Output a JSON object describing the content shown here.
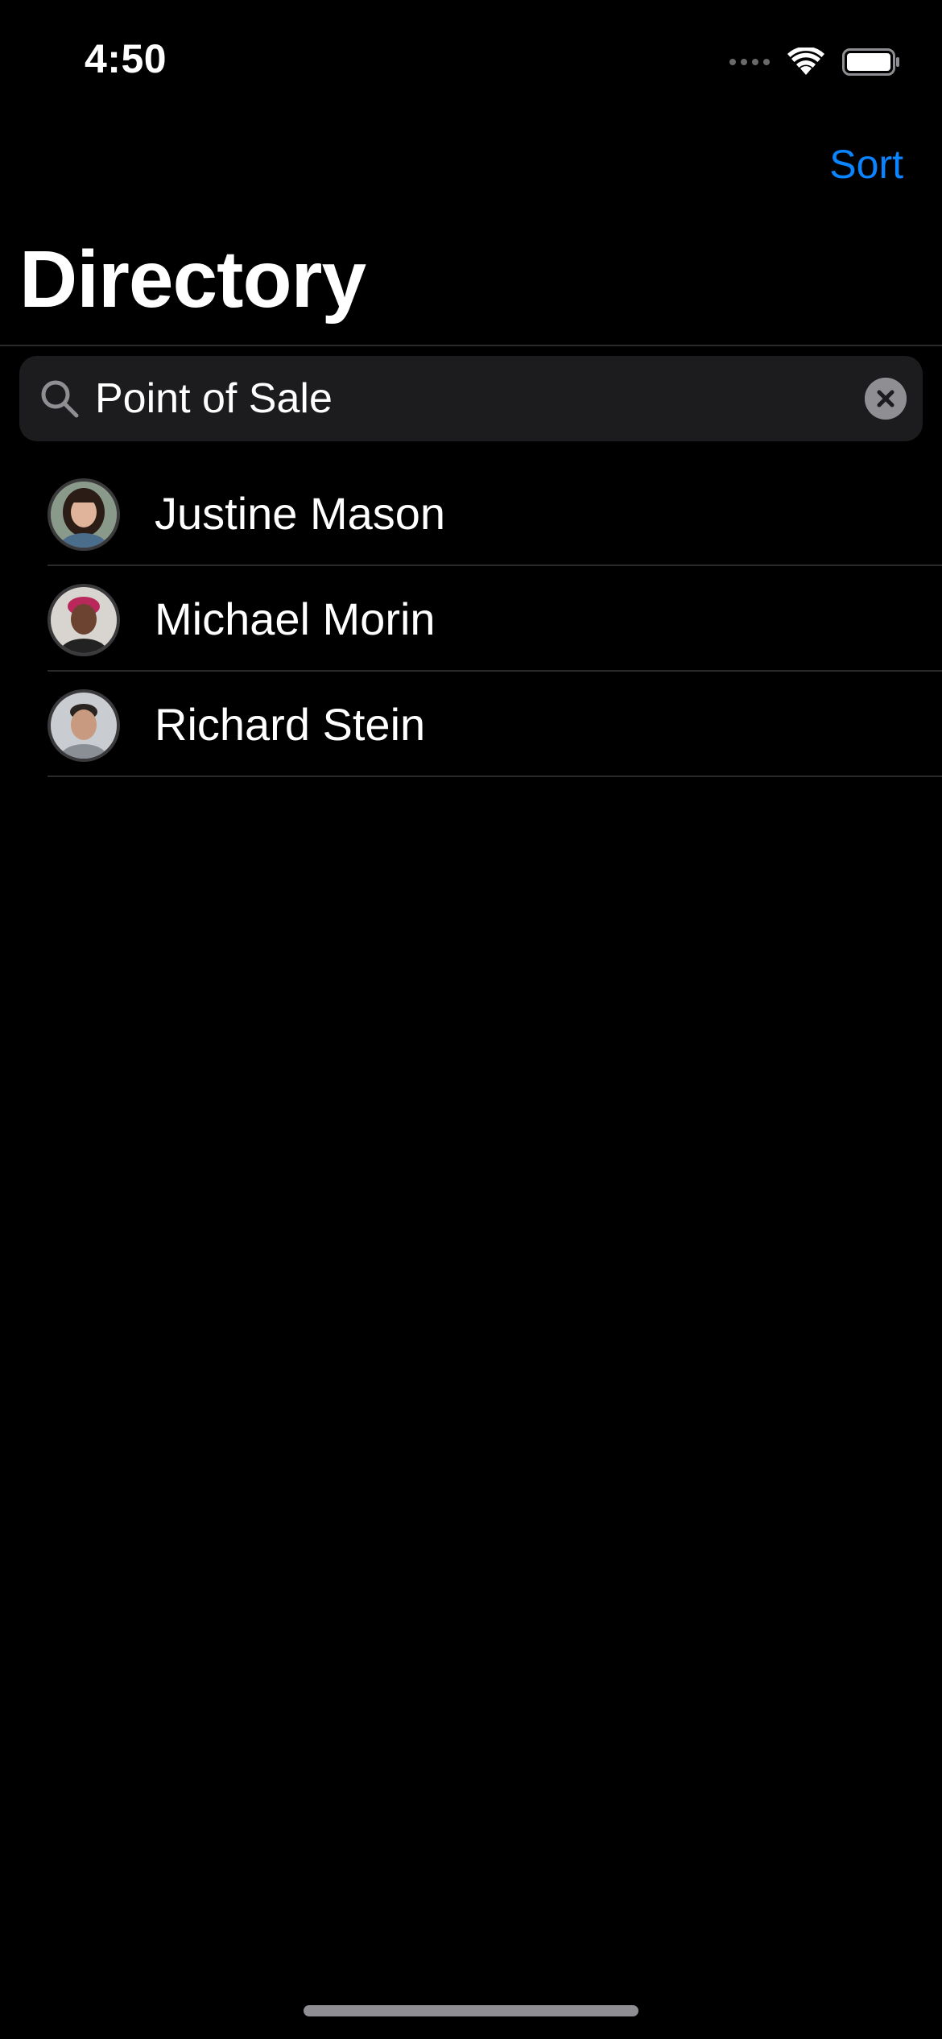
{
  "status_bar": {
    "time": "4:50"
  },
  "nav": {
    "sort_label": "Sort",
    "title": "Directory"
  },
  "search": {
    "value": "Point of Sale",
    "placeholder": "Search"
  },
  "contacts": [
    {
      "name": "Justine Mason"
    },
    {
      "name": "Michael Morin"
    },
    {
      "name": "Richard Stein"
    }
  ],
  "colors": {
    "background": "#000000",
    "accent": "#0a84ff",
    "search_bg": "#1c1c1e",
    "separator": "#2a2a2c"
  },
  "icons": {
    "wifi": "wifi-icon",
    "battery": "battery-icon",
    "search": "search-icon",
    "clear": "clear-icon"
  }
}
